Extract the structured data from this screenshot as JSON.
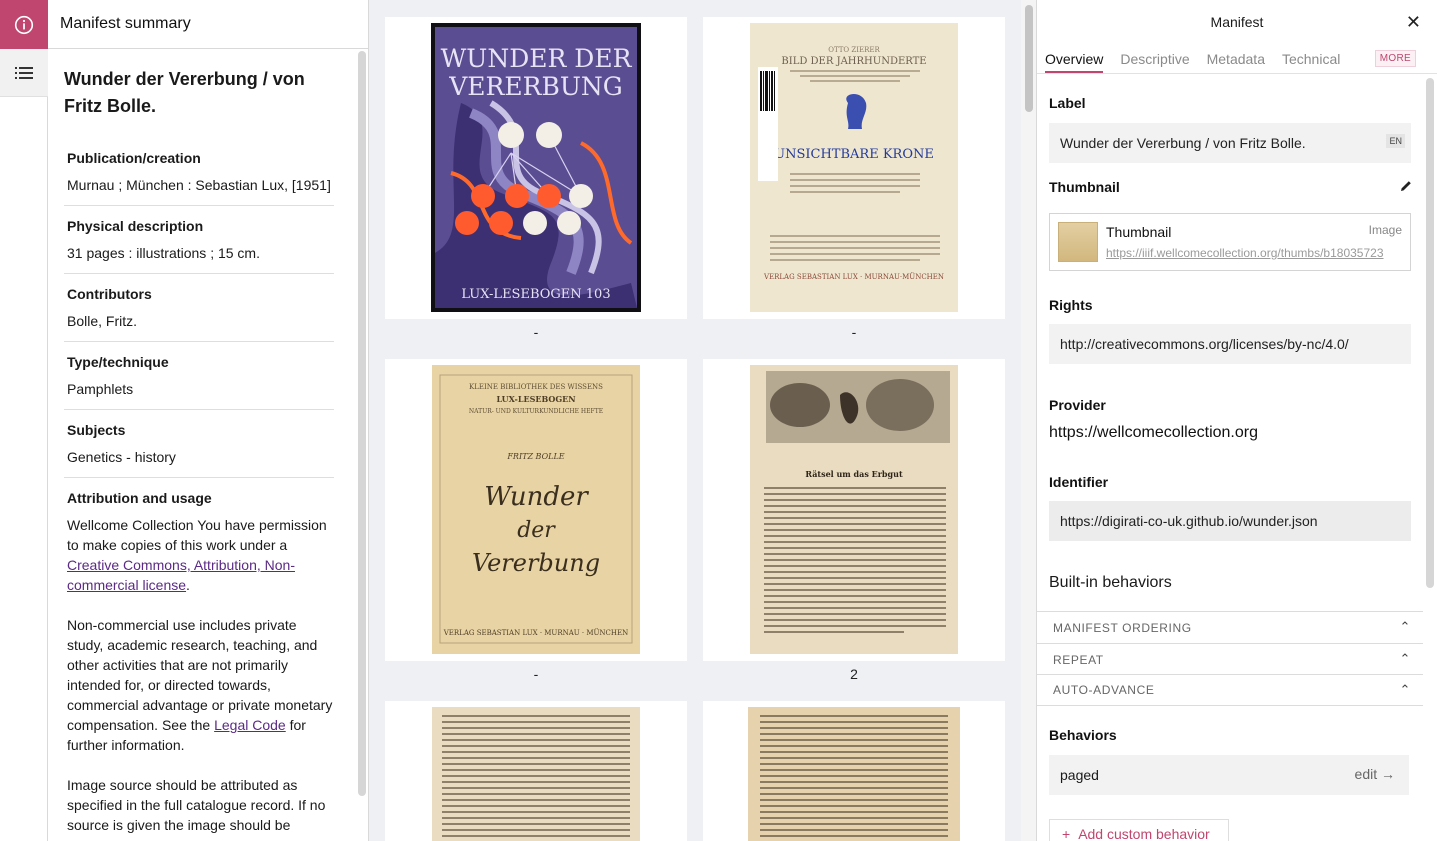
{
  "rail": {
    "info_icon": "info-icon",
    "list_icon": "list-icon"
  },
  "summary": {
    "header": "Manifest summary",
    "title": "Wunder der Vererbung / von Fritz Bolle.",
    "meta": [
      {
        "label": "Publication/creation",
        "value": "Murnau ; München : Sebastian Lux, [1951]"
      },
      {
        "label": "Physical description",
        "value": "31 pages : illustrations ; 15 cm."
      },
      {
        "label": "Contributors",
        "value": "Bolle, Fritz."
      },
      {
        "label": "Type/technique",
        "value": "Pamphlets"
      },
      {
        "label": "Subjects",
        "value": "Genetics - history"
      }
    ],
    "attribution": {
      "label": "Attribution and usage",
      "p1_pre": "Wellcome Collection You have permission to make copies of this work under a ",
      "p1_link": "Creative Commons, Attribution, Non-commercial license",
      "p1_post": ".",
      "p2_pre": "Non-commercial use includes private study, academic research, teaching, and other activities that are not primarily intended for, or directed towards, commercial advantage or private monetary compensation. See the ",
      "p2_link": "Legal Code",
      "p2_post": " for further information.",
      "p3": "Image source should be attributed as specified in the full catalogue record. If no source is given the image should be"
    }
  },
  "grid": {
    "captions": [
      "-",
      "-",
      "-",
      "2"
    ],
    "cover_text": {
      "top1": "WUNDER DER",
      "top2": "VERERBUNG",
      "bottom": "LUX-LESEBOGEN 103"
    },
    "page2": {
      "author": "OTTO ZIERER",
      "title": "BILD DER JAHRHUNDERTE",
      "subtitle": "UNSICHTBARE KRONE",
      "publisher": "VERLAG SEBASTIAN LUX · MURNAU·MÜNCHEN"
    },
    "page3": {
      "series": "KLEINE BIBLIOTHEK DES WISSENS",
      "series2": "LUX-LESEBOGEN",
      "series3": "NATUR- UND KULTURKUNDLICHE HEFTE",
      "author": "FRITZ BOLLE",
      "script1": "Wunder",
      "script2": "der",
      "script3": "Vererbung",
      "publisher": "VERLAG SEBASTIAN LUX · MURNAU · MÜNCHEN"
    },
    "page4": {
      "heading": "Rätsel um das Erbgut"
    }
  },
  "right": {
    "title": "Manifest",
    "tabs": [
      "Overview",
      "Descriptive",
      "Metadata",
      "Technical"
    ],
    "more": "MORE",
    "label_title": "Label",
    "label_value": "Wunder der Vererbung / von Fritz Bolle.",
    "lang": "EN",
    "thumb_title": "Thumbnail",
    "thumb_name": "Thumbnail",
    "thumb_type": "Image",
    "thumb_url": "https://iiif.wellcomecollection.org/thumbs/b18035723",
    "rights_title": "Rights",
    "rights_value": "http://creativecommons.org/licenses/by-nc/4.0/",
    "provider_title": "Provider",
    "provider_value": "https://wellcomecollection.org",
    "identifier_title": "Identifier",
    "identifier_value": "https://digirati-co-uk.github.io/wunder.json",
    "builtin_title": "Built-in behaviors",
    "accordions": [
      "MANIFEST ORDERING",
      "REPEAT",
      "AUTO-ADVANCE"
    ],
    "behaviors_title": "Behaviors",
    "behavior_value": "paged",
    "behavior_edit": "edit",
    "add_behavior": "Add custom behavior"
  }
}
